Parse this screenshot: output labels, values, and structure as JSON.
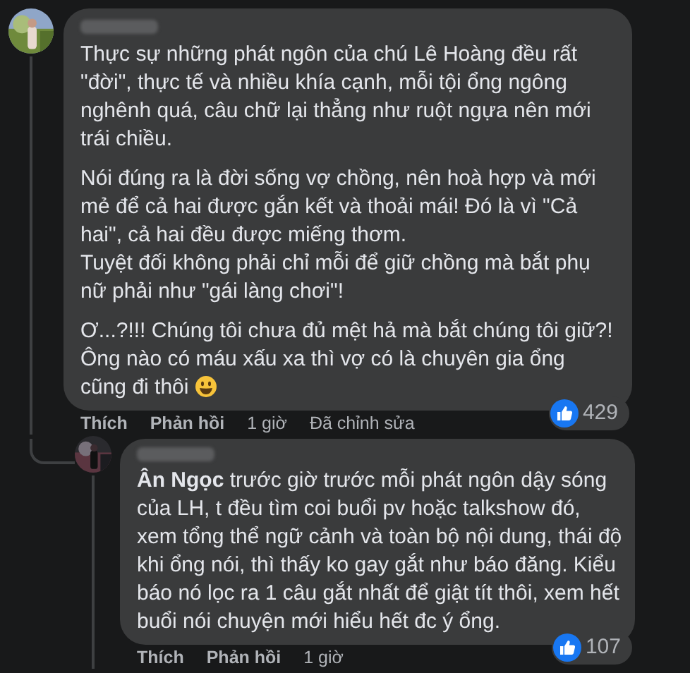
{
  "comments": [
    {
      "paragraphs": [
        [
          "Thực sự những phát ngôn của chú Lê Hoàng đều rất \"đời\", thực tế và nhiều khía cạnh, mỗi tội ổng ngông nghênh quá, câu chữ lại thẳng như ruột ngựa nên mới trái chiều."
        ],
        [
          "Nói đúng ra là đời sống vợ chồng, nên hoà hợp và mới mẻ để cả hai được gắn kết và thoải mái! Đó là vì \"Cả hai\", cả hai đều được miếng thơm.",
          "Tuyệt đối không phải chỉ mỗi để giữ chồng mà bắt phụ nữ phải như \"gái làng chơi\"!"
        ],
        [
          "Ơ...?!!! Chúng tôi chưa đủ mệt hả mà bắt chúng tôi giữ?! Ông nào có máu xấu xa thì vợ có là chuyên gia ổng cũng đi thôi"
        ]
      ],
      "ends_with_emoji": true,
      "reactions": "429",
      "actions": [
        "Thích",
        "Phản hồi",
        "1 giờ",
        "Đã chỉnh sửa"
      ],
      "replies": [
        {
          "paragraphs": [
            [
              "**Ân Ngọc** trước giờ trước mỗi phát ngôn dậy sóng của LH, t đều tìm coi buổi pv hoặc talkshow đó, xem tổng thể ngữ cảnh và toàn bộ nội dung, thái độ khi ổng nói, thì thấy ko gay gắt như báo đăng. Kiểu báo nó lọc ra 1 câu gắt nhất để giật tít thôi, xem hết buổi nói chuyện mới hiểu hết đc ý ổng."
            ]
          ],
          "ends_with_emoji": false,
          "reactions": "107",
          "actions": [
            "Thích",
            "Phản hồi",
            "1 giờ"
          ]
        }
      ]
    }
  ]
}
